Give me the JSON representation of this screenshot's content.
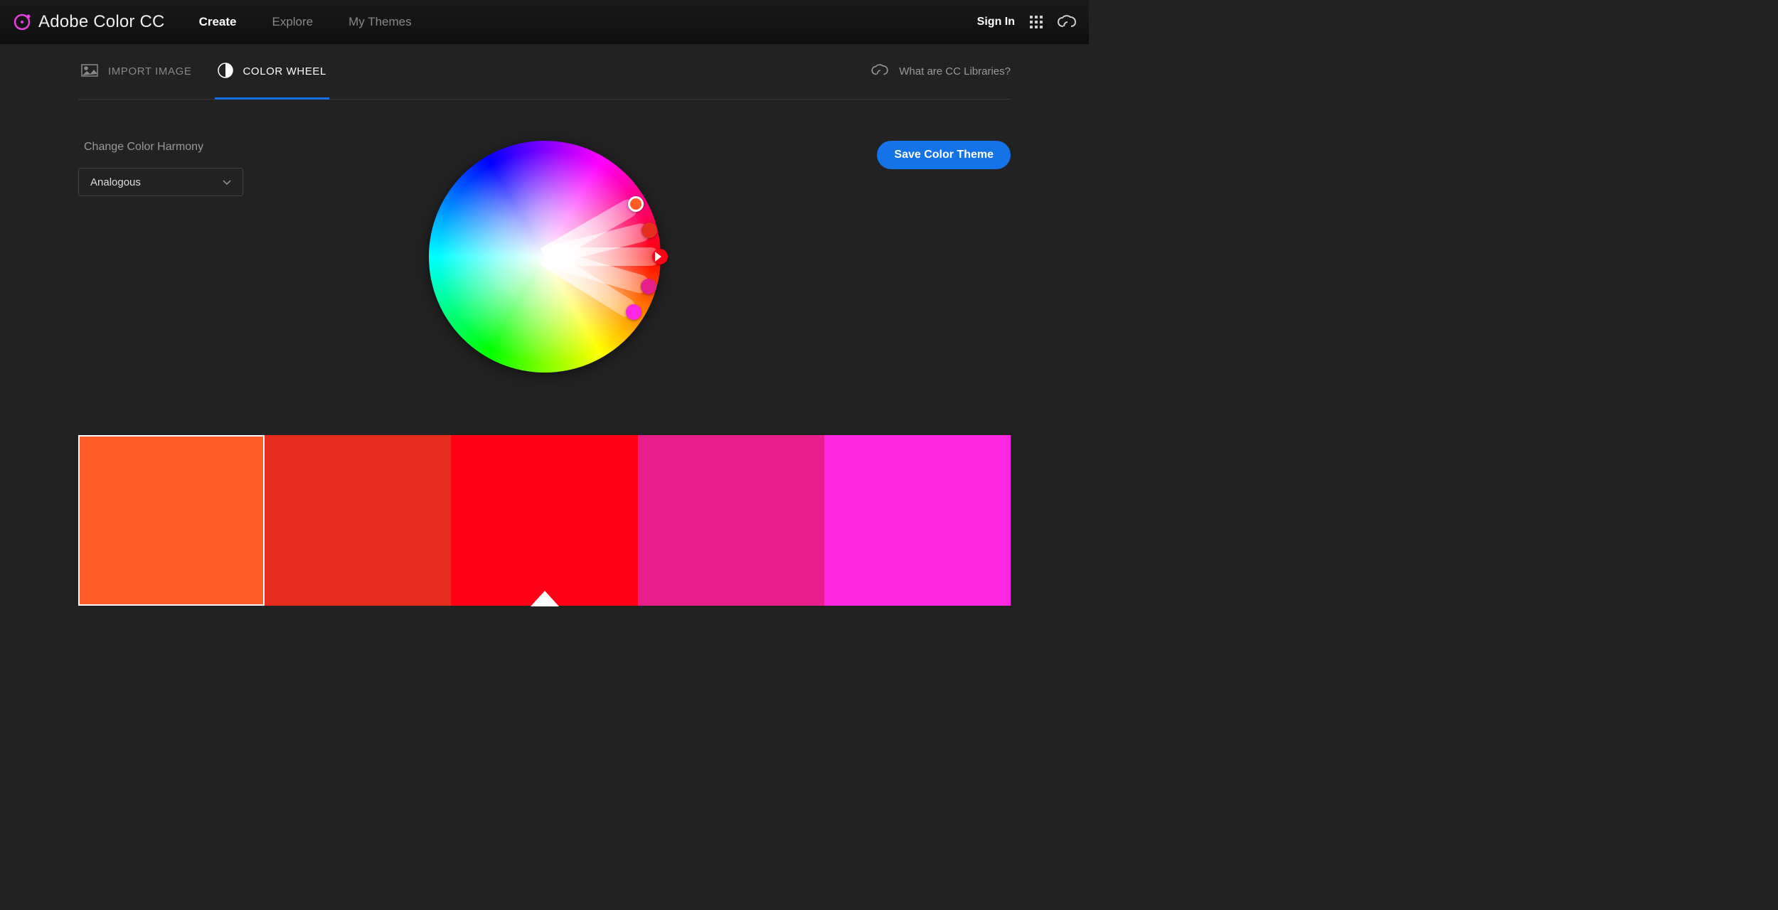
{
  "header": {
    "app_title": "Adobe Color CC",
    "nav": [
      "Create",
      "Explore",
      "My Themes"
    ],
    "active_nav": "Create",
    "sign_in": "Sign In"
  },
  "tabs": {
    "import_image": "IMPORT IMAGE",
    "color_wheel": "COLOR WHEEL",
    "active": "COLOR WHEEL",
    "cc_libraries_link": "What are CC Libraries?"
  },
  "harmony": {
    "label": "Change Color Harmony",
    "selected": "Analogous"
  },
  "save_button": "Save Color Theme",
  "swatches": [
    {
      "hex": "#FF5C26",
      "selected": true,
      "base": false
    },
    {
      "hex": "#E62E1F",
      "selected": false,
      "base": false
    },
    {
      "hex": "#FF0015",
      "selected": false,
      "base": true
    },
    {
      "hex": "#E61F8B",
      "selected": false,
      "base": false
    },
    {
      "hex": "#FF26E2",
      "selected": false,
      "base": false
    }
  ],
  "wheel": {
    "markers": [
      {
        "angle": -30,
        "radius": 148,
        "color": "#FF5C26",
        "selected": true,
        "base": false
      },
      {
        "angle": -14,
        "radius": 152,
        "color": "#E62E1F",
        "selected": false,
        "base": false
      },
      {
        "angle": 0,
        "radius": 162,
        "color": "#FF0015",
        "selected": false,
        "base": true
      },
      {
        "angle": 16,
        "radius": 152,
        "color": "#E61F8B",
        "selected": false,
        "base": false
      },
      {
        "angle": 32,
        "radius": 148,
        "color": "#FF26E2",
        "selected": false,
        "base": false
      }
    ]
  }
}
